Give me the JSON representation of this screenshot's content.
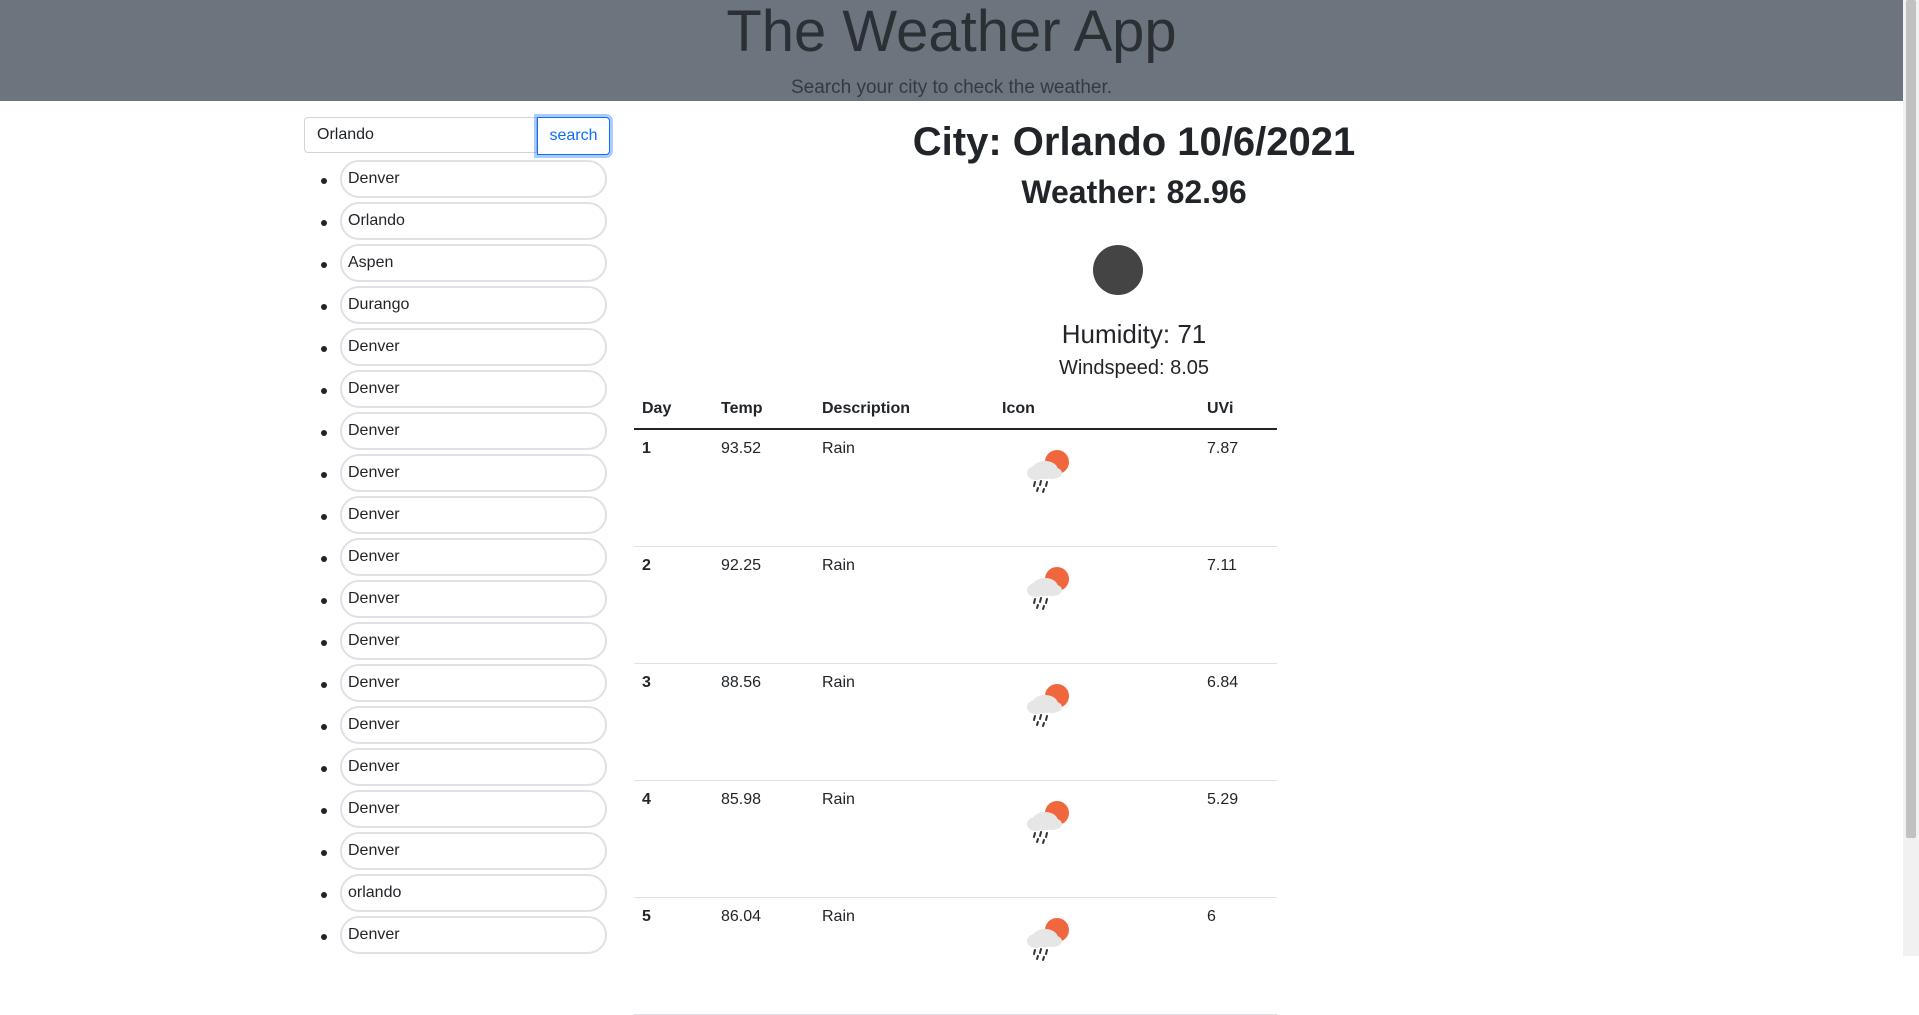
{
  "header": {
    "title": "The Weather App",
    "subtitle": "Search your city to check the weather."
  },
  "search": {
    "value": "Orlando",
    "button_label": "search"
  },
  "history": [
    "Denver",
    "Orlando",
    "Aspen",
    "Durango",
    "Denver",
    "Denver",
    "Denver",
    "Denver",
    "Denver",
    "Denver",
    "Denver",
    "Denver",
    "Denver",
    "Denver",
    "Denver",
    "Denver",
    "Denver",
    "orlando",
    "Denver"
  ],
  "current": {
    "city": "City: Orlando 10/6/2021",
    "weather": "Weather: 82.96",
    "humidity": "Humidity: 71",
    "windspeed": "Windspeed: 8.05",
    "icon": "weather-icon"
  },
  "forecast": {
    "headers": [
      "Day",
      "Temp",
      "Description",
      "Icon",
      "UVi"
    ],
    "rows": [
      {
        "day": "1",
        "temp": "93.52",
        "description": "Rain",
        "icon": "rain-sun-icon",
        "uvi": "7.87"
      },
      {
        "day": "2",
        "temp": "92.25",
        "description": "Rain",
        "icon": "rain-sun-icon",
        "uvi": "7.11"
      },
      {
        "day": "3",
        "temp": "88.56",
        "description": "Rain",
        "icon": "rain-sun-icon",
        "uvi": "6.84"
      },
      {
        "day": "4",
        "temp": "85.98",
        "description": "Rain",
        "icon": "rain-sun-icon",
        "uvi": "5.29"
      },
      {
        "day": "5",
        "temp": "86.04",
        "description": "Rain",
        "icon": "rain-sun-icon",
        "uvi": "6"
      }
    ]
  },
  "colors": {
    "header_bg": "#6c757d",
    "accent": "#0d6efd",
    "sun": "#f0663d",
    "cloud": "#e6e6e6"
  }
}
